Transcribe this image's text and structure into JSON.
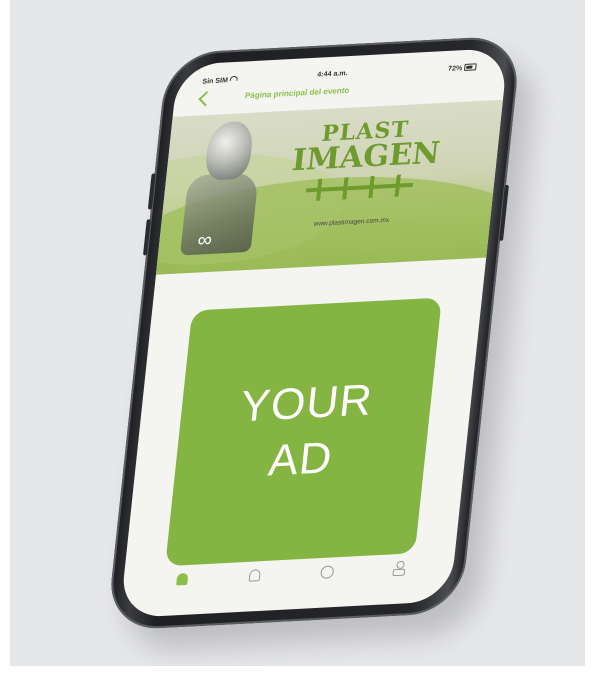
{
  "statusbar": {
    "carrier": "Sin SIM",
    "time": "4:44 a.m.",
    "battery": "72%"
  },
  "navbar": {
    "title": "Página principal del evento"
  },
  "banner": {
    "brand_line1": "PLAST",
    "brand_line2": "IMAGEN",
    "url": "www.plastimagen.com.mx"
  },
  "ad": {
    "line1": "YOUR",
    "line2": "AD",
    "color": "#84b441"
  },
  "tabbar": {
    "items": [
      {
        "icon": "home-icon",
        "active": true
      },
      {
        "icon": "bell-icon",
        "active": false
      },
      {
        "icon": "coin-icon",
        "active": false
      },
      {
        "icon": "user-icon",
        "active": false
      }
    ]
  },
  "colors": {
    "accent": "#8cc04a",
    "background": "#e6e7e9",
    "phone_frame": "#26272b"
  }
}
